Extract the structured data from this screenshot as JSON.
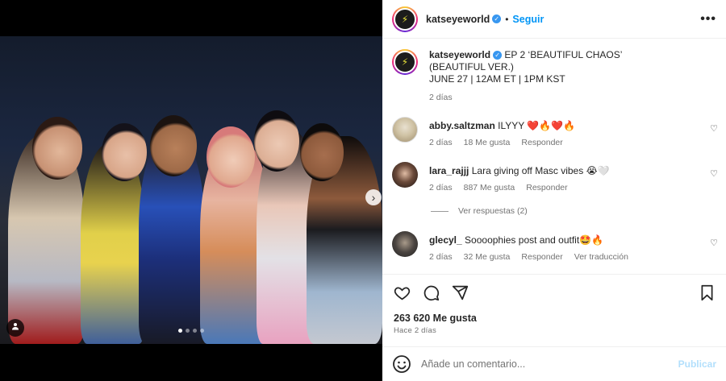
{
  "post": {
    "username": "katseyeworld",
    "follow_label": "Seguir",
    "separator": "•",
    "more_label": "•••"
  },
  "caption": {
    "username": "katseyeworld",
    "line1": "EP 2 ‘BEAUTIFUL CHAOS’",
    "line2": "(BEAUTIFUL VER.)",
    "line3": "JUNE 27 | 12AM ET | 1PM KST",
    "time": "2 días"
  },
  "comments": [
    {
      "username": "abby.saltzman",
      "text": "ILYYY ❤️🔥❤️🔥",
      "time": "2 días",
      "likes": "18 Me gusta",
      "reply": "Responder"
    },
    {
      "username": "lara_rajjj",
      "text": "Lara giving off Masc vibes 😭🤍",
      "time": "2 días",
      "likes": "887 Me gusta",
      "reply": "Responder"
    },
    {
      "username": "glecyl_",
      "text": "Soooophies post and outfit🤩🔥",
      "time": "2 días",
      "likes": "32 Me gusta",
      "reply": "Responder",
      "translate": "Ver traducción"
    }
  ],
  "view_replies": "Ver respuestas (2)",
  "likes_total": "263 620 Me gusta",
  "posted_ago": "Hace 2 días",
  "add_comment": {
    "placeholder": "Añade un comentario...",
    "publish": "Publicar"
  },
  "icons": {
    "like": "heart-icon",
    "comment": "comment-icon",
    "share": "send-icon",
    "save": "bookmark-icon",
    "emoji": "smiley-icon",
    "tag": "user-tag-icon",
    "next": "chevron-right-icon"
  },
  "colors": {
    "accent": "#0095f6",
    "publish_disabled": "#b2dffc",
    "verified": "#3897f0"
  }
}
